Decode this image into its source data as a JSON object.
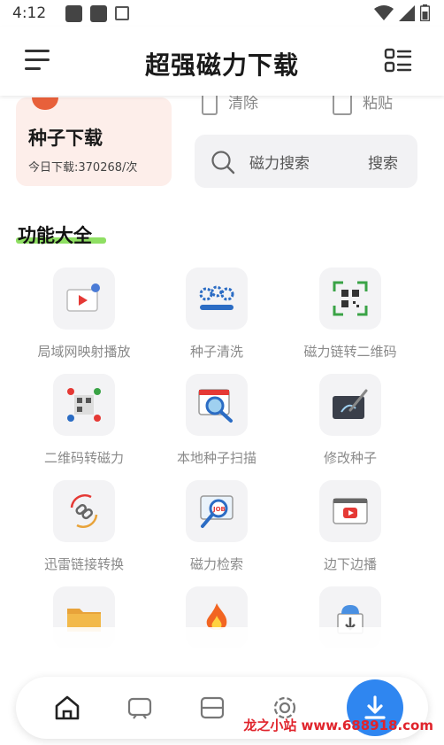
{
  "status_bar": {
    "time": "4:12",
    "icons": [
      "notification-square-icon",
      "notification-square-icon",
      "a-badge-icon",
      "wifi-icon",
      "signal-icon",
      "battery-icon"
    ]
  },
  "header": {
    "title": "超强磁力下载",
    "menu_icon": "hamburger-menu-icon",
    "right_icon": "list-grid-icon"
  },
  "seed_card": {
    "title": "种子下载",
    "subtitle": "今日下载:370268/次",
    "accent": "#e8603a",
    "bg": "#fdeeea"
  },
  "partial_actions": [
    {
      "label": "清除",
      "icon": "trash-icon"
    },
    {
      "label": "粘贴",
      "icon": "paste-icon"
    }
  ],
  "search": {
    "placeholder": "磁力搜索",
    "button": "搜索",
    "icon": "search-icon"
  },
  "section": {
    "title": "功能大全",
    "underline_color": "#7bd948"
  },
  "features": [
    {
      "label": "局域网映射播放",
      "icon": "cast-screen-icon"
    },
    {
      "label": "种子清洗",
      "icon": "gears-progress-icon"
    },
    {
      "label": "磁力链转二维码",
      "icon": "qr-scan-icon"
    },
    {
      "label": "二维码转磁力",
      "icon": "qr-nodes-icon"
    },
    {
      "label": "本地种子扫描",
      "icon": "magnifier-window-icon"
    },
    {
      "label": "修改种子",
      "icon": "tablet-pen-icon"
    },
    {
      "label": "迅雷链接转换",
      "icon": "link-convert-icon"
    },
    {
      "label": "磁力检索",
      "icon": "job-search-icon"
    },
    {
      "label": "边下边播",
      "icon": "video-play-icon"
    },
    {
      "label": "",
      "icon": "folder-zip-icon"
    },
    {
      "label": "",
      "icon": "fire-icon"
    },
    {
      "label": "",
      "icon": "cloud-download-icon"
    }
  ],
  "bottom_nav": {
    "items": [
      "home-icon",
      "tv-icon",
      "cards-icon",
      "settings-gear-icon"
    ],
    "download_icon": "download-icon",
    "accent": "#2f86f0"
  },
  "watermark": "龙之小站 www.688918.com"
}
